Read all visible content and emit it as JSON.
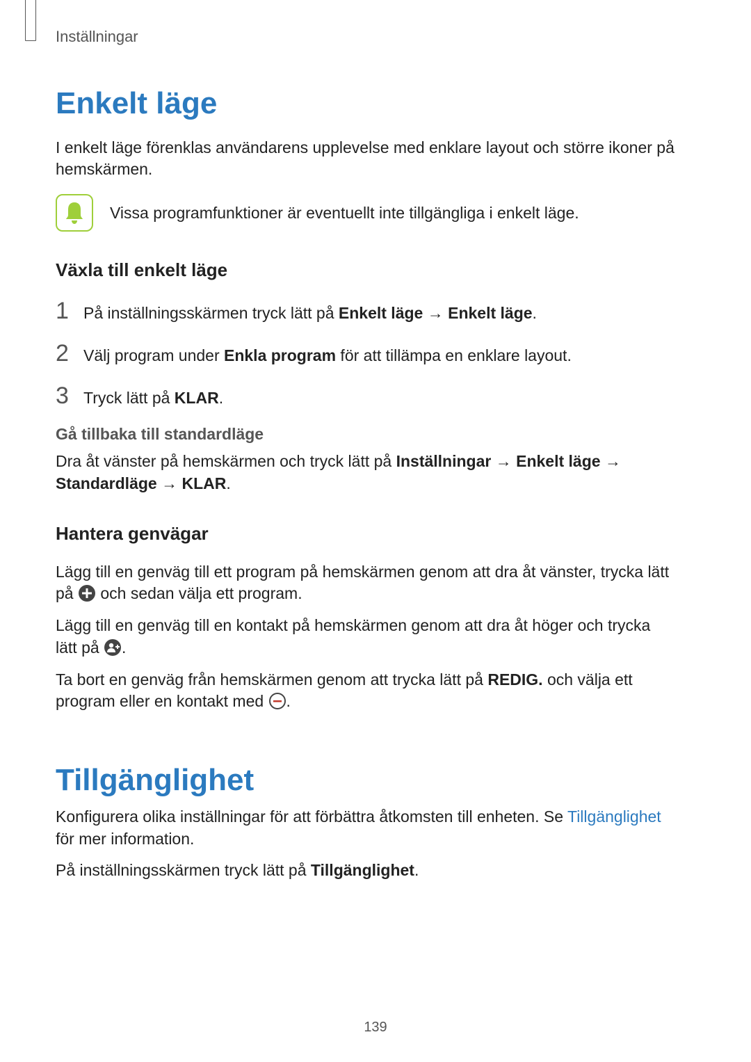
{
  "breadcrumb": "Inställningar",
  "section1": {
    "title": "Enkelt läge",
    "intro": "I enkelt läge förenklas användarens upplevelse med enklare layout och större ikoner på hemskärmen.",
    "note": "Vissa programfunktioner är eventuellt inte tillgängliga i enkelt läge.",
    "switch": {
      "title": "Växla till enkelt läge",
      "step1_a": "På inställningsskärmen tryck lätt på ",
      "step1_b": "Enkelt läge",
      "step1_arrow": " → ",
      "step1_c": "Enkelt läge",
      "step1_end": ".",
      "step2_a": "Välj program under ",
      "step2_b": "Enkla program",
      "step2_c": " för att tillämpa en enklare layout.",
      "step3_a": "Tryck lätt på ",
      "step3_b": "KLAR",
      "step3_end": "."
    },
    "back": {
      "title": "Gå tillbaka till standardläge",
      "a": "Dra åt vänster på hemskärmen och tryck lätt på ",
      "b": "Inställningar",
      "arrow1": " → ",
      "c": "Enkelt läge",
      "arrow2": " → ",
      "d": "Standardläge",
      "arrow3": " → ",
      "e": "KLAR",
      "end": "."
    },
    "shortcuts": {
      "title": "Hantera genvägar",
      "p1a": "Lägg till en genväg till ett program på hemskärmen genom att dra åt vänster, trycka lätt på ",
      "p1b": " och sedan välja ett program.",
      "p2a": "Lägg till en genväg till en kontakt på hemskärmen genom att dra åt höger och trycka lätt på ",
      "p2end": ".",
      "p3a": "Ta bort en genväg från hemskärmen genom att trycka lätt på ",
      "p3b": "REDIG.",
      "p3c": " och välja ett program eller en kontakt med ",
      "p3end": "."
    }
  },
  "section2": {
    "title": "Tillgänglighet",
    "p1a": "Konfigurera olika inställningar för att förbättra åtkomsten till enheten. Se ",
    "p1link": "Tillgänglighet",
    "p1b": " för mer information.",
    "p2a": "På inställningsskärmen tryck lätt på ",
    "p2b": "Tillgänglighet",
    "p2end": "."
  },
  "page_number": "139"
}
